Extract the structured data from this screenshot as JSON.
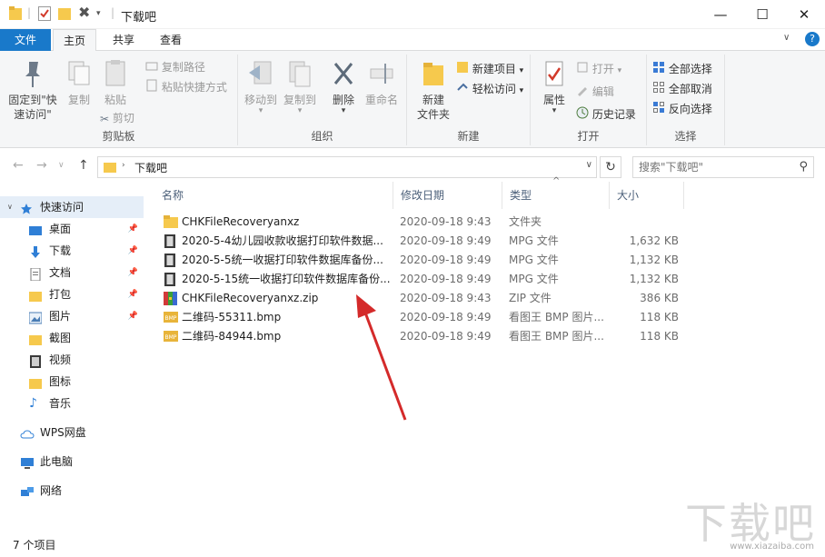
{
  "window": {
    "title": "下载吧",
    "controls": {
      "minimize": "—",
      "maximize": "☐",
      "close": "✕"
    },
    "help": "?"
  },
  "tabs": [
    {
      "label": "文件"
    },
    {
      "label": "主页"
    },
    {
      "label": "共享"
    },
    {
      "label": "查看"
    }
  ],
  "ribbon": {
    "clipboard": {
      "group_label": "剪贴板",
      "pin": "固定到\"快\n速访问\"",
      "copy": "复制",
      "paste": "粘贴",
      "copy_path": "复制路径",
      "paste_shortcut": "粘贴快捷方式",
      "cut": "剪切"
    },
    "organize": {
      "group_label": "组织",
      "move_to": "移动到",
      "copy_to": "复制到",
      "delete": "删除",
      "rename": "重命名"
    },
    "new": {
      "group_label": "新建",
      "new_folder": "新建\n文件夹",
      "new_item": "新建项目",
      "easy_access": "轻松访问"
    },
    "open": {
      "group_label": "打开",
      "properties": "属性",
      "open": "打开",
      "edit": "编辑",
      "history": "历史记录"
    },
    "select": {
      "group_label": "选择",
      "select_all": "全部选择",
      "select_none": "全部取消",
      "invert": "反向选择"
    }
  },
  "address": {
    "path": "下载吧",
    "search_placeholder": "搜索\"下载吧\"",
    "refresh": "↻"
  },
  "navpane": {
    "quick_access": "快速访问",
    "items": [
      {
        "label": "桌面",
        "pinned": true
      },
      {
        "label": "下载",
        "pinned": true
      },
      {
        "label": "文档",
        "pinned": true
      },
      {
        "label": "打包",
        "pinned": true
      },
      {
        "label": "图片",
        "pinned": true
      },
      {
        "label": "截图",
        "pinned": false
      },
      {
        "label": "视频",
        "pinned": false
      },
      {
        "label": "图标",
        "pinned": false
      },
      {
        "label": "音乐",
        "pinned": false
      }
    ],
    "wps": "WPS网盘",
    "this_pc": "此电脑",
    "network": "网络"
  },
  "columns": {
    "name": "名称",
    "date": "修改日期",
    "type": "类型",
    "size": "大小"
  },
  "files": [
    {
      "name": "CHKFileRecoveryanxz",
      "date": "2020-09-18 9:43",
      "type": "文件夹",
      "size": "",
      "icon": "folder-icon"
    },
    {
      "name": "2020-5-4幼儿园收款收据打印软件数据...",
      "date": "2020-09-18 9:49",
      "type": "MPG 文件",
      "size": "1,632 KB",
      "icon": "video-file-icon"
    },
    {
      "name": "2020-5-5统一收据打印软件数据库备份...",
      "date": "2020-09-18 9:49",
      "type": "MPG 文件",
      "size": "1,132 KB",
      "icon": "video-file-icon"
    },
    {
      "name": "2020-5-15统一收据打印软件数据库备份...",
      "date": "2020-09-18 9:49",
      "type": "MPG 文件",
      "size": "1,132 KB",
      "icon": "video-file-icon"
    },
    {
      "name": "CHKFileRecoveryanxz.zip",
      "date": "2020-09-18 9:43",
      "type": "ZIP 文件",
      "size": "386 KB",
      "icon": "zip-file-icon"
    },
    {
      "name": "二维码-55311.bmp",
      "date": "2020-09-18 9:49",
      "type": "看图王 BMP 图片...",
      "size": "118 KB",
      "icon": "bmp-file-icon"
    },
    {
      "name": "二维码-84944.bmp",
      "date": "2020-09-18 9:49",
      "type": "看图王 BMP 图片...",
      "size": "118 KB",
      "icon": "bmp-file-icon"
    }
  ],
  "status": {
    "count": "7 个项目"
  },
  "watermark": {
    "text": "下载吧",
    "sub": "www.xiazaiba.com"
  },
  "colors": {
    "accent": "#1979ca",
    "annotation_arrow": "#d42a2a"
  }
}
